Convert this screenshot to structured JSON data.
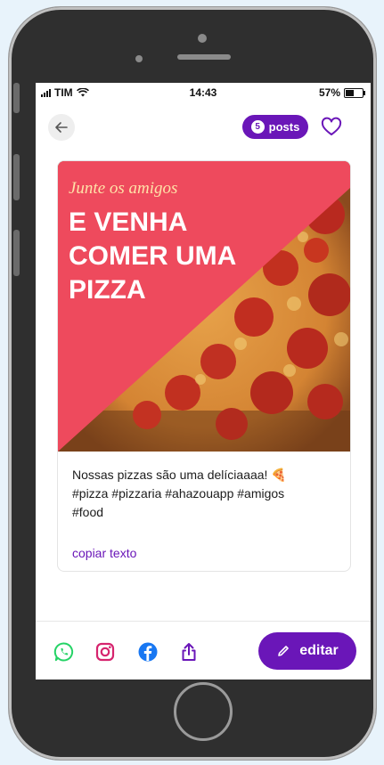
{
  "status_bar": {
    "carrier": "TIM",
    "time": "14:43",
    "battery": "57%",
    "battery_level": 0.57
  },
  "header": {
    "posts_count": "5",
    "posts_label": "posts"
  },
  "post": {
    "image": {
      "script_text": "Junte os amigos",
      "headline_lines": [
        "E VENHA",
        "COMER UMA",
        "PIZZA"
      ],
      "panel_color": "#ee4a5d"
    },
    "caption_lines": [
      "Nossas pizzas são uma delíciaaaa! 🍕",
      "#pizza #pizzaria #ahazouapp #amigos",
      "#food"
    ],
    "copy_label": "copiar texto"
  },
  "actions": {
    "icons": [
      "whatsapp-icon",
      "instagram-icon",
      "facebook-icon",
      "share-icon"
    ],
    "edit_label": "editar"
  },
  "colors": {
    "accent": "#6a16b8",
    "whatsapp": "#25d366",
    "instagram": "#d6246e",
    "facebook": "#1877f2"
  }
}
